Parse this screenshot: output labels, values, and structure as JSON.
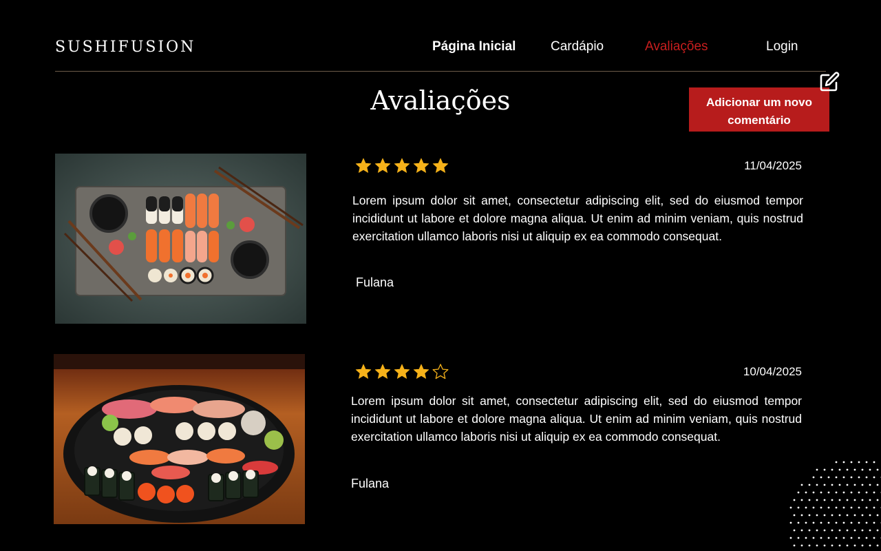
{
  "header": {
    "logo": "SUSHIFUSION",
    "nav": {
      "home": "Página Inicial",
      "menu": "Cardápio",
      "reviews": "Avaliações",
      "login": "Login"
    }
  },
  "main": {
    "title": "Avaliações",
    "add_button_label": "Adicionar um novo comentário"
  },
  "reviews": [
    {
      "rating": 5,
      "max_rating": 5,
      "date": "11/04/2025",
      "text": "Lorem ipsum dolor sit amet, consectetur adipiscing elit, sed do eiusmod tempor incididunt ut labore et dolore magna aliqua. Ut enim ad minim veniam, quis nostrud exercitation ullamco laboris nisi ut aliquip ex ea commodo consequat.",
      "author": "Fulana"
    },
    {
      "rating": 4,
      "max_rating": 5,
      "date": "10/04/2025",
      "text": "Lorem ipsum dolor sit amet, consectetur adipiscing elit, sed do eiusmod tempor incididunt ut labore et dolore magna aliqua. Ut enim ad minim veniam, quis nostrud exercitation ullamco laboris nisi ut aliquip ex ea commodo consequat.",
      "author": "Fulana"
    }
  ],
  "colors": {
    "accent": "#b71c1c",
    "active_nav": "#c81e1e",
    "star": "#f6b21a",
    "divider": "#6e5c4a"
  },
  "icons": {
    "edit": "edit-icon",
    "star_full": "star-filled-icon",
    "star_empty": "star-outline-icon"
  }
}
